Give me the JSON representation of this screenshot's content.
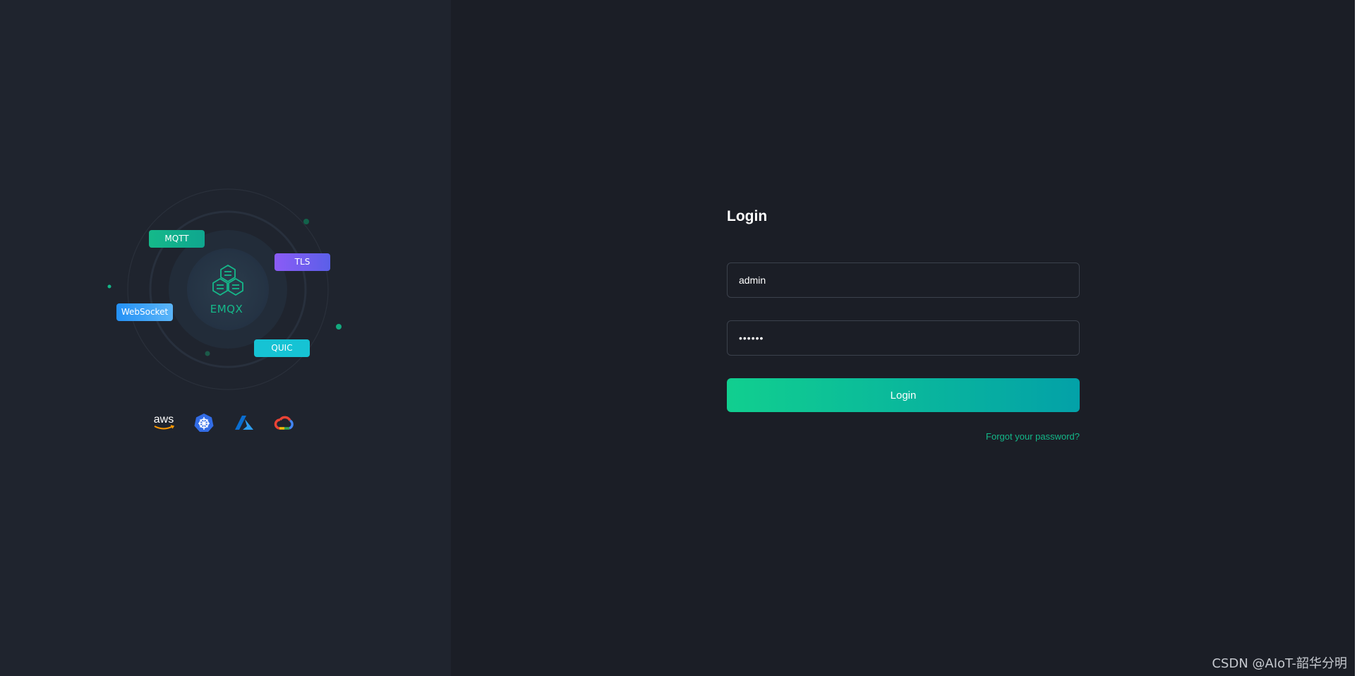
{
  "illustration": {
    "tags": {
      "mqtt": "MQTT",
      "tls": "TLS",
      "websocket": "WebSocket",
      "quic": "QUIC"
    },
    "logo_text": "EMQX",
    "clouds": {
      "aws_label": "aws",
      "icons": [
        "aws-icon",
        "kubernetes-icon",
        "azure-icon",
        "google-cloud-icon"
      ]
    }
  },
  "form": {
    "title": "Login",
    "username_value": "admin",
    "password_value": "••••••",
    "login_button": "Login",
    "forgot_link": "Forgot your password?"
  },
  "watermark": "CSDN @AIoT-韶华分明",
  "colors": {
    "accent": "#13b889",
    "background": "#1b1e26",
    "left_panel": "#1f242e"
  }
}
